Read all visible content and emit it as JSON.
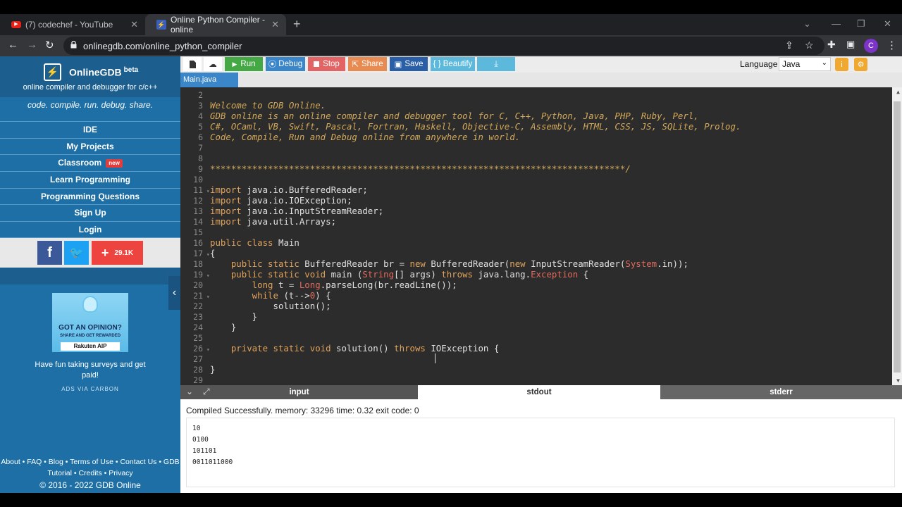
{
  "browser": {
    "tabs": [
      {
        "title": "(7) codechef - YouTube"
      },
      {
        "title": "Online Python Compiler - online"
      }
    ],
    "url": "onlinegdb.com/online_python_compiler",
    "profile_initial": "C"
  },
  "sidebar": {
    "brand": "OnlineGDB",
    "beta": "beta",
    "subtitle": "online compiler and debugger for c/c++",
    "tagline": "code. compile. run. debug. share.",
    "menu": [
      {
        "label": "IDE"
      },
      {
        "label": "My Projects"
      },
      {
        "label": "Classroom",
        "badge": "new"
      },
      {
        "label": "Learn Programming"
      },
      {
        "label": "Programming Questions"
      },
      {
        "label": "Sign Up"
      },
      {
        "label": "Login"
      }
    ],
    "share_count": "29.1K",
    "ad": {
      "title": "GOT AN OPINION?",
      "sub": "SHARE AND GET REWARDED",
      "brand": "Rakuten AIP",
      "text": "Have fun taking surveys and get paid!",
      "via": "ADS VIA CARBON"
    },
    "footer_line1": "About • FAQ • Blog • Terms of Use • Contact Us • GDB",
    "footer_line2": "Tutorial • Credits • Privacy",
    "copyright": "© 2016 - 2022 GDB Online"
  },
  "toolbar": {
    "run": "Run",
    "debug": "Debug",
    "stop": "Stop",
    "share": "Share",
    "save": "Save",
    "beautify": "{ } Beautify",
    "language_label": "Language",
    "language_value": "Java"
  },
  "file_tab": "Main.java",
  "code_lines": [
    {
      "n": "2",
      "tokens": []
    },
    {
      "n": "3",
      "tokens": [
        {
          "t": "Welcome to GDB Online.",
          "c": "cm"
        }
      ]
    },
    {
      "n": "4",
      "tokens": [
        {
          "t": "GDB online is an online compiler and debugger tool for C, C++, Python, Java, PHP, Ruby, Perl,",
          "c": "cm"
        }
      ]
    },
    {
      "n": "5",
      "tokens": [
        {
          "t": "C#, OCaml, VB, Swift, Pascal, Fortran, Haskell, Objective-C, Assembly, HTML, CSS, JS, SQLite, Prolog.",
          "c": "cm"
        }
      ]
    },
    {
      "n": "6",
      "tokens": [
        {
          "t": "Code, Compile, Run and Debug online from anywhere in world.",
          "c": "cm"
        }
      ]
    },
    {
      "n": "7",
      "tokens": []
    },
    {
      "n": "8",
      "tokens": []
    },
    {
      "n": "9",
      "tokens": [
        {
          "t": "*******************************************************************************/",
          "c": "cm"
        }
      ]
    },
    {
      "n": "10",
      "tokens": []
    },
    {
      "n": "11",
      "fold": true,
      "tokens": [
        {
          "t": "import",
          "c": "kw"
        },
        {
          "t": " java.io.BufferedReader;",
          "c": "code"
        }
      ]
    },
    {
      "n": "12",
      "tokens": [
        {
          "t": "import",
          "c": "kw"
        },
        {
          "t": " java.io.IOException;",
          "c": "code"
        }
      ]
    },
    {
      "n": "13",
      "tokens": [
        {
          "t": "import",
          "c": "kw"
        },
        {
          "t": " java.io.InputStreamReader;",
          "c": "code"
        }
      ]
    },
    {
      "n": "14",
      "tokens": [
        {
          "t": "import",
          "c": "kw"
        },
        {
          "t": " java.util.Arrays;",
          "c": "code"
        }
      ]
    },
    {
      "n": "15",
      "tokens": []
    },
    {
      "n": "16",
      "tokens": [
        {
          "t": "public class",
          "c": "kw"
        },
        {
          "t": " Main",
          "c": "code"
        }
      ]
    },
    {
      "n": "17",
      "fold": true,
      "tokens": [
        {
          "t": "{",
          "c": "code"
        }
      ]
    },
    {
      "n": "18",
      "tokens": [
        {
          "t": "    public static",
          "c": "kw"
        },
        {
          "t": " BufferedReader br = ",
          "c": "code"
        },
        {
          "t": "new",
          "c": "kw"
        },
        {
          "t": " BufferedReader(",
          "c": "code"
        },
        {
          "t": "new",
          "c": "kw"
        },
        {
          "t": " InputStreamReader(",
          "c": "code"
        },
        {
          "t": "System",
          "c": "cls"
        },
        {
          "t": ".in));",
          "c": "code"
        }
      ]
    },
    {
      "n": "19",
      "fold": true,
      "tokens": [
        {
          "t": "    public static void",
          "c": "kw"
        },
        {
          "t": " main (",
          "c": "code"
        },
        {
          "t": "String",
          "c": "cls"
        },
        {
          "t": "[] args) ",
          "c": "code"
        },
        {
          "t": "throws",
          "c": "kw"
        },
        {
          "t": " java.lang.",
          "c": "code"
        },
        {
          "t": "Exception",
          "c": "cls"
        },
        {
          "t": " {",
          "c": "code"
        }
      ]
    },
    {
      "n": "20",
      "tokens": [
        {
          "t": "        long",
          "c": "kw"
        },
        {
          "t": " t = ",
          "c": "code"
        },
        {
          "t": "Long",
          "c": "cls"
        },
        {
          "t": ".parseLong(br.readLine());",
          "c": "code"
        }
      ]
    },
    {
      "n": "21",
      "fold": true,
      "tokens": [
        {
          "t": "        while",
          "c": "kw"
        },
        {
          "t": " (t-->",
          "c": "code"
        },
        {
          "t": "0",
          "c": "num"
        },
        {
          "t": ") {",
          "c": "code"
        }
      ]
    },
    {
      "n": "22",
      "tokens": [
        {
          "t": "            solution();",
          "c": "code"
        }
      ]
    },
    {
      "n": "23",
      "tokens": [
        {
          "t": "        }",
          "c": "code"
        }
      ]
    },
    {
      "n": "24",
      "tokens": [
        {
          "t": "    }",
          "c": "code"
        }
      ]
    },
    {
      "n": "25",
      "tokens": []
    },
    {
      "n": "26",
      "fold": true,
      "tokens": [
        {
          "t": "    private static void",
          "c": "kw"
        },
        {
          "t": " solution() ",
          "c": "code"
        },
        {
          "t": "throws",
          "c": "kw"
        },
        {
          "t": " IOException {",
          "c": "code"
        }
      ]
    },
    {
      "n": "27",
      "tokens": []
    },
    {
      "n": "28",
      "tokens": [
        {
          "t": "}",
          "c": "code"
        }
      ]
    },
    {
      "n": "29",
      "tokens": []
    }
  ],
  "io_tabs": {
    "input": "input",
    "stdout": "stdout",
    "stderr": "stderr"
  },
  "status": "Compiled Successfully. memory: 33296 time: 0.32 exit code: 0",
  "output_lines": [
    "10",
    "0100",
    "101101",
    "0011011000"
  ]
}
